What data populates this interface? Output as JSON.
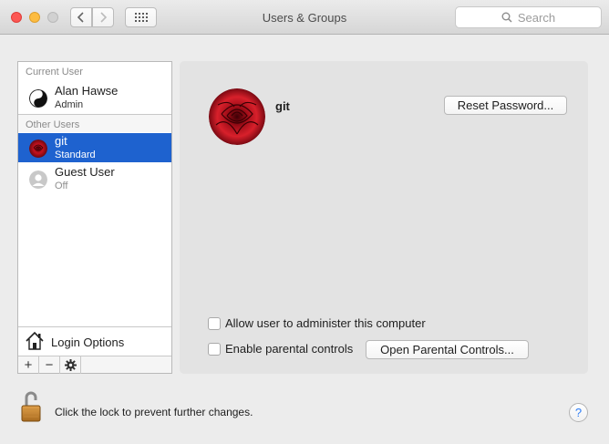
{
  "window": {
    "title": "Users & Groups",
    "search_placeholder": "Search"
  },
  "sidebar": {
    "current_user_header": "Current User",
    "other_users_header": "Other Users",
    "current_user": {
      "name": "Alan Hawse",
      "role": "Admin",
      "icon": "yin-yang-icon"
    },
    "other_users": [
      {
        "name": "git",
        "role": "Standard",
        "icon": "red-rose-avatar",
        "selected": true
      },
      {
        "name": "Guest User",
        "role": "Off",
        "icon": "guest-silhouette-icon",
        "selected": false
      }
    ],
    "login_options_label": "Login Options",
    "tools": {
      "add": "+",
      "remove": "−",
      "action": "gear-icon"
    }
  },
  "panel": {
    "username": "git",
    "reset_password_label": "Reset Password...",
    "admin_checkbox_label": "Allow user to administer this computer",
    "admin_checked": false,
    "parental_checkbox_label": "Enable parental controls",
    "parental_checked": false,
    "open_parental_label": "Open Parental Controls..."
  },
  "footer": {
    "lock_text": "Click the lock to prevent further changes.",
    "lock_state": "unlocked",
    "help_label": "?"
  },
  "colors": {
    "selection": "#1e62cf",
    "panel_bg": "#e3e3e3",
    "window_bg": "#ececec"
  }
}
